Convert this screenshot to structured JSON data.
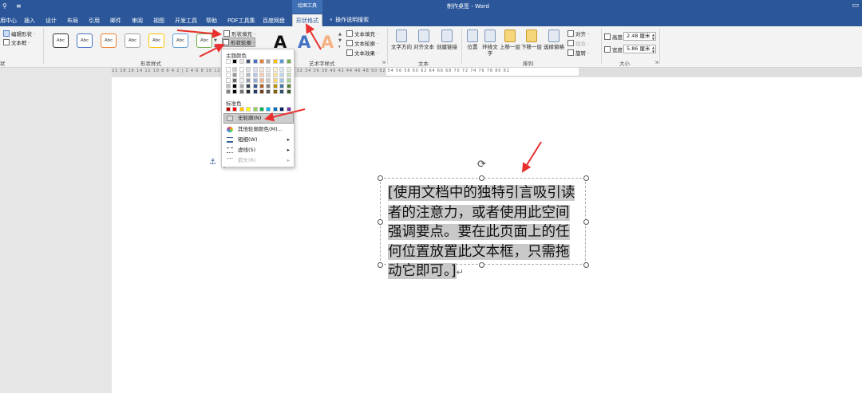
{
  "title_bar": {
    "contextual_group": "绘图工具",
    "document_title": "制作桌签 - Word",
    "window_controls": "▭"
  },
  "tabs": [
    {
      "label": "用中心"
    },
    {
      "label": "插入"
    },
    {
      "label": "设计"
    },
    {
      "label": "布局"
    },
    {
      "label": "引用"
    },
    {
      "label": "邮件"
    },
    {
      "label": "审阅"
    },
    {
      "label": "视图"
    },
    {
      "label": "开发工具"
    },
    {
      "label": "帮助"
    },
    {
      "label": "PDF工具集"
    },
    {
      "label": "百度网盘"
    },
    {
      "label": "形状格式",
      "active": true
    }
  ],
  "tell_me": "操作说明搜索",
  "ribbon": {
    "insert_shapes": {
      "edit_shape": "编辑形状 ·",
      "text_box": "文本框 ·",
      "group_label_fragment": "状"
    },
    "shape_styles": {
      "style_label": "Abc",
      "style_border_colors": [
        "#333333",
        "#4472c4",
        "#ed7d31",
        "#a5a5a5",
        "#ffc000",
        "#5b9bd5",
        "#70ad47"
      ],
      "fill": "形状填充 ·",
      "outline": "形状轮廓 ·",
      "group_label": "形状样式"
    },
    "wordart": {
      "letters": [
        "A",
        "A",
        "A"
      ],
      "letter_colors": [
        "#111111",
        "#4472c4",
        "#f4b183"
      ],
      "text_fill": "文本填充 ·",
      "text_outline": "文本轮廓 ·",
      "text_effects": "文本效果 ·",
      "group_label": "艺术字样式"
    },
    "text": {
      "direction": "文字方向",
      "align": "对齐文本",
      "link": "创建链接",
      "group_label": "文本"
    },
    "arrange": {
      "position": "位置",
      "wrap": "环绕文字",
      "forward": "上移一层",
      "backward": "下移一层",
      "pane": "选择窗格",
      "align": "对齐 ·",
      "group": "组合 ·",
      "rotate": "旋转 ·",
      "group_label": "排列"
    },
    "size": {
      "height_label": "高度:",
      "height_value": "2.48 厘米",
      "width_label": "宽度:",
      "width_value": "5.86 厘米",
      "group_label": "大小"
    }
  },
  "ruler": {
    "numbers": "21 18 16 14 12 10 8 6 4 2 | 2 4 6 8 10 12 14 16 18 20 22 24 26 28 30 32 34 36 38 40 42 44 46 48 50 52 54 56 58 60 62 64 66 68 70 72 74 76 78 80 82"
  },
  "outline_dropdown": {
    "theme_colors_title": "主题颜色",
    "theme_colors": [
      "#ffffff",
      "#000000",
      "#e7e6e6",
      "#44546a",
      "#4472c4",
      "#ed7d31",
      "#a5a5a5",
      "#ffc000",
      "#5b9bd5",
      "#70ad47"
    ],
    "standard_colors_title": "标准色",
    "standard_colors": [
      "#c00000",
      "#ff0000",
      "#ffc000",
      "#ffff00",
      "#92d050",
      "#00b050",
      "#00b0f0",
      "#0070c0",
      "#002060",
      "#7030a0"
    ],
    "items": [
      {
        "label": "无轮廓(N)",
        "highlighted": true
      },
      {
        "label": "其他轮廓颜色(M)..."
      },
      {
        "label": "粗细(W)",
        "submenu": true
      },
      {
        "label": "虚线(S)",
        "submenu": true
      },
      {
        "label": "箭头(R)",
        "submenu": true,
        "disabled": true
      }
    ]
  },
  "document": {
    "textbox_text": "[使用文档中的独特引言吸引读者的注意力，或者使用此空间强调要点。要在此页面上的任何位置放置此文本框，只需拖动它即可。]",
    "return_mark": "↵"
  }
}
